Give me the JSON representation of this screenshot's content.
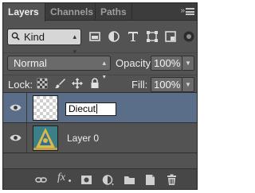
{
  "tabs": [
    {
      "label": "Layers",
      "active": true
    },
    {
      "label": "Channels",
      "active": false
    },
    {
      "label": "Paths",
      "active": false
    }
  ],
  "filter": {
    "kind_label": "Kind",
    "icons": [
      "pixel-layer-filter-icon",
      "adjustment-layer-filter-icon",
      "type-layer-filter-icon",
      "shape-layer-filter-icon",
      "smart-object-filter-icon",
      "filter-toggle-icon"
    ]
  },
  "blend": {
    "mode": "Normal",
    "opacity_label": "Opacity:",
    "opacity_value": "100%"
  },
  "lock": {
    "label": "Lock:",
    "icons": [
      "lock-transparent-pixels-icon",
      "lock-image-pixels-icon",
      "lock-position-icon",
      "lock-all-icon"
    ],
    "fill_label": "Fill:",
    "fill_value": "100%"
  },
  "layers": [
    {
      "name": "Diecut",
      "visible": true,
      "selected": true,
      "editing": true,
      "thumbnail": "transparent"
    },
    {
      "name": "Layer 0",
      "visible": true,
      "selected": false,
      "editing": false,
      "thumbnail": "image"
    }
  ],
  "footer_icons": [
    "link-layers-icon",
    "add-layer-style-icon",
    "add-mask-icon",
    "new-adjustment-layer-icon",
    "new-group-icon",
    "new-layer-icon",
    "delete-layer-icon"
  ],
  "colors": {
    "panel_bg": "#535353",
    "selected_row": "#5a6d89",
    "tab_bar": "#3c3c3c"
  }
}
